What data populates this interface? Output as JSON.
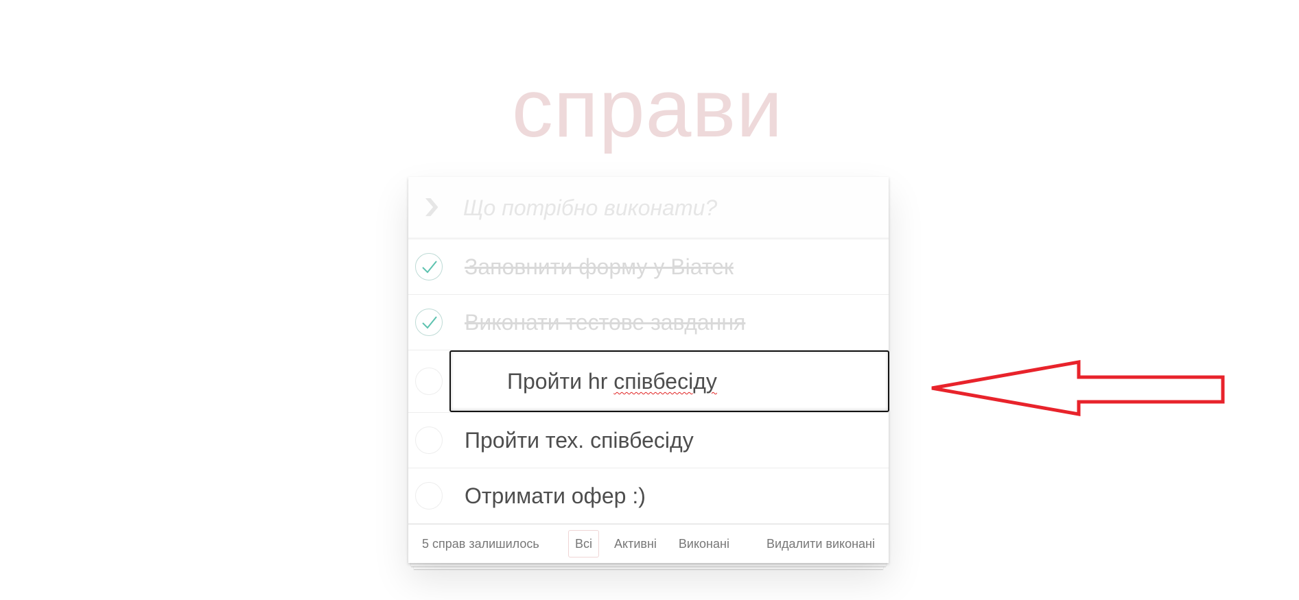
{
  "app": {
    "title": "справи"
  },
  "new_todo": {
    "placeholder": "Що потрібно виконати?",
    "value": ""
  },
  "todos": [
    {
      "label": "Заповнити форму у Віатек",
      "completed": true,
      "editing": false
    },
    {
      "label": "Виконати тестове завдання",
      "completed": true,
      "editing": false
    },
    {
      "label": "Пройти hr співбесіду",
      "completed": false,
      "editing": true,
      "misspelled_word": "співбесіду"
    },
    {
      "label": "Пройти тех. співбесіду",
      "completed": false,
      "editing": false
    },
    {
      "label": "Отримати офер :)",
      "completed": false,
      "editing": false
    }
  ],
  "edit_text_prefix": "Пройти hr ",
  "footer": {
    "count_text": "5 справ залишилось",
    "filters": [
      {
        "label": "Всі",
        "selected": true
      },
      {
        "label": "Активні",
        "selected": false
      },
      {
        "label": "Виконані",
        "selected": false
      }
    ],
    "clear_completed": "Видалити виконані"
  },
  "colors": {
    "title": "#eed9da",
    "check_mark": "#5dc2af",
    "selected_filter_border": "#efd5d5",
    "annotation_arrow": "#e8232b"
  },
  "icons": {
    "toggle_all": "chevron-down-icon",
    "completed_check": "checkmark-icon",
    "annotation": "arrow-left-icon"
  }
}
